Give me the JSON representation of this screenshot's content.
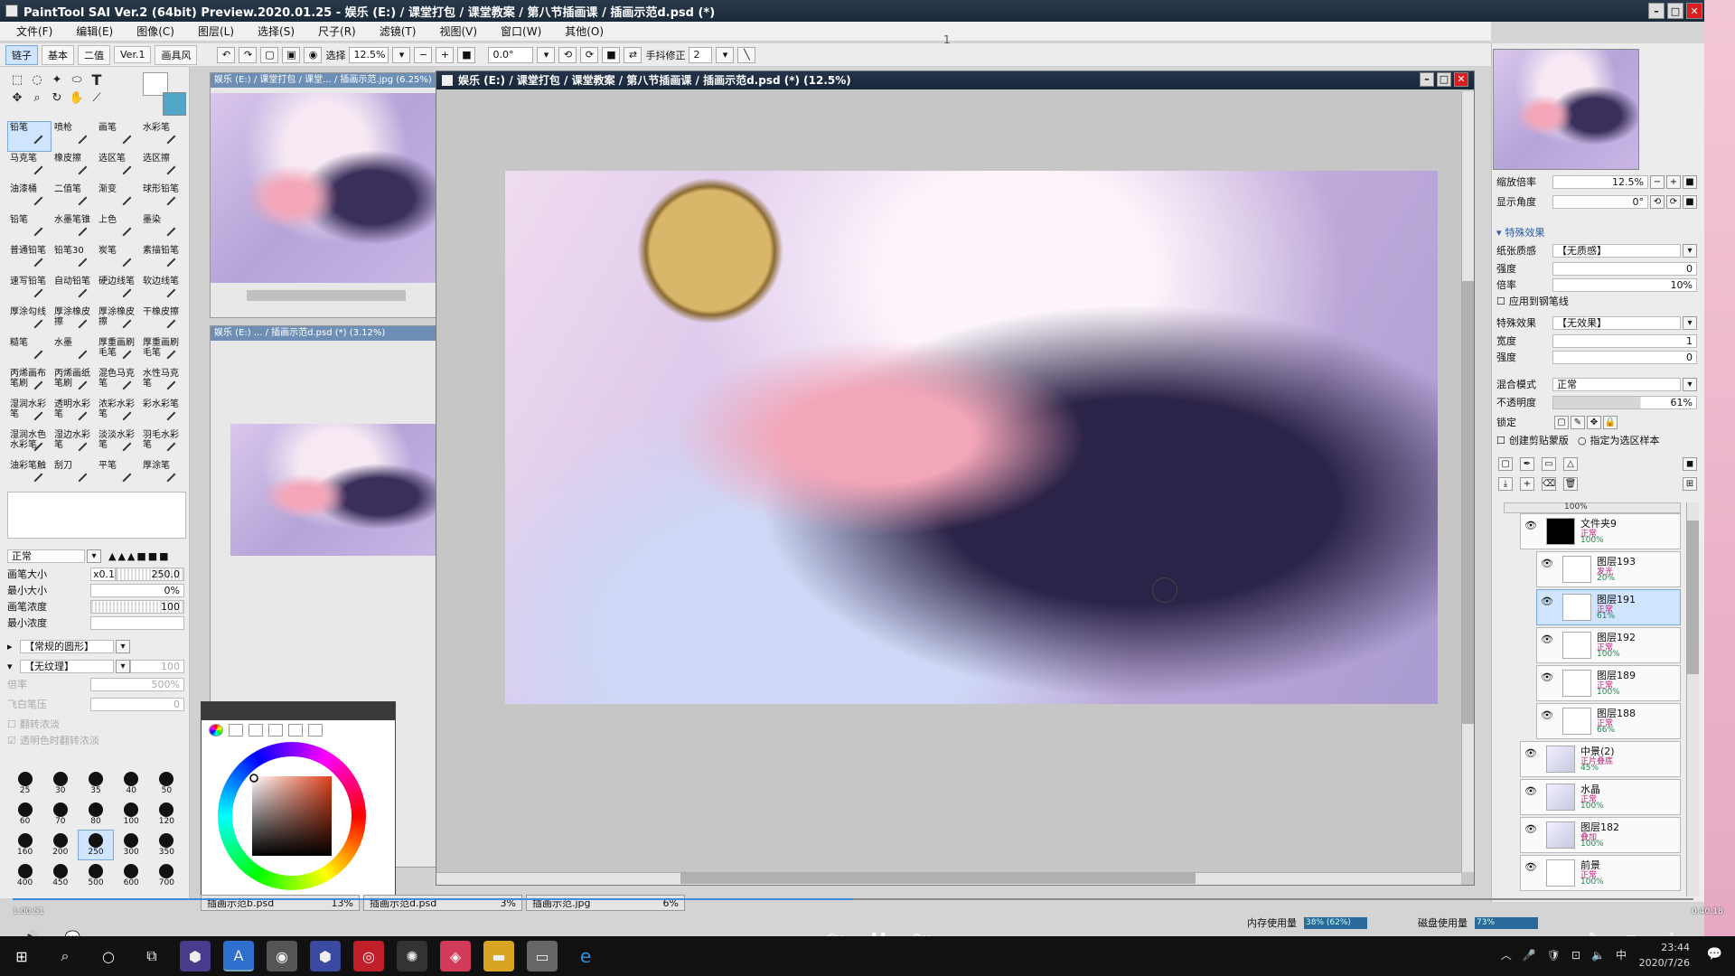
{
  "window": {
    "title": "PaintTool SAI Ver.2 (64bit) Preview.2020.01.25 - 娱乐 (E:) / 课堂打包 / 课堂教案 / 第八节插画课 / 插画示范d.psd (*)",
    "page_indicator": "1"
  },
  "menu": [
    "文件(F)",
    "编辑(E)",
    "图像(C)",
    "图层(L)",
    "选择(S)",
    "尺子(R)",
    "滤镜(T)",
    "视图(V)",
    "窗口(W)",
    "其他(O)"
  ],
  "toolbar": {
    "tabs": [
      "链子",
      "基本",
      "二值",
      "Ver.1",
      "画具风"
    ],
    "select_label": "选择",
    "zoom": "12.5%",
    "angle": "0.0°",
    "stabilizer_label": "手抖修正",
    "stabilizer_value": "2"
  },
  "brushes": [
    "铅笔",
    "喷枪",
    "画笔",
    "水彩笔",
    "马克笔",
    "橡皮擦",
    "选区笔",
    "选区擦",
    "油漆桶",
    "二值笔",
    "渐变",
    "球形铅笔",
    "铅笔",
    "水墨笔锥",
    "上色",
    "墨染",
    "普通铅笔",
    "铅笔30",
    "炭笔",
    "素描铅笔",
    "速写铅笔",
    "自动铅笔",
    "硬边线笔",
    "软边线笔",
    "厚涂勾线",
    "厚涂橡皮擦",
    "厚涂橡皮擦",
    "干橡皮擦",
    "糙笔",
    "水墨",
    "厚重画刷毛笔",
    "厚重画刷毛笔",
    "丙烯画布笔刷",
    "丙烯画纸笔刷",
    "混色马克笔",
    "水性马克笔",
    "湿润水彩笔",
    "透明水彩笔",
    "浓彩水彩笔",
    "彩水彩笔",
    "湿润水色水彩笔",
    "湿边水彩笔",
    "淡淡水彩笔",
    "羽毛水彩笔",
    "油彩笔触",
    "刮刀",
    "平笔",
    "厚涂笔"
  ],
  "brush_settings": {
    "mode": "正常",
    "size_label": "画笔大小",
    "size_mult": "x0.1",
    "size_value": "250.0",
    "min_size_label": "最小大小",
    "min_size_value": "0%",
    "density_label": "画笔浓度",
    "density_value": "100",
    "min_density_label": "最小浓度",
    "shape_label": "【常规的圆形】",
    "texture_label": "【无纹理】",
    "texture_value": "100",
    "texture_strength_label": "倍率",
    "texture_strength_value": "500%",
    "fly_label": "飞白笔压",
    "fly_value": "0",
    "opt1": "翻转浓淡",
    "opt2": "透明色时翻转浓淡"
  },
  "brush_sizes": [
    "25",
    "30",
    "35",
    "40",
    "50",
    "60",
    "70",
    "80",
    "100",
    "120",
    "160",
    "200",
    "250",
    "300",
    "350",
    "400",
    "450",
    "500",
    "600",
    "700"
  ],
  "documents": {
    "left_thumb_title": "娱乐 (E:) / 课堂打包 / 课堂... / 插画示范.jpg (6.25%)",
    "left_thumb2_title": "娱乐 (E:) ... / 插画示范d.psd (*) (3.12%)",
    "main_title": "娱乐 (E:) / 课堂打包 / 课堂教案 / 第八节插画课 / 插画示范d.psd (*) (12.5%)"
  },
  "navigator": {
    "zoom_label": "缩放倍率",
    "zoom_value": "12.5%",
    "angle_label": "显示角度",
    "angle_value": "0°"
  },
  "effects": {
    "section": "特殊效果",
    "paper_label": "纸张质感",
    "paper_value": "【无质感】",
    "strength_label": "强度",
    "strength_value": "0",
    "rate_label": "倍率",
    "rate_value": "10%",
    "apply_label": "应用到钢笔线",
    "effect_label": "特殊效果",
    "effect_value": "【无效果】",
    "width_label": "宽度",
    "width_value": "1",
    "strength2_label": "强度",
    "strength2_value": "0"
  },
  "layer_props": {
    "blend_label": "混合模式",
    "blend_value": "正常",
    "opacity_label": "不透明度",
    "opacity_value": "61%",
    "lock_label": "锁定",
    "clip_label": "创建剪贴蒙版",
    "sample_label": "指定为选区样本"
  },
  "layers": [
    {
      "name": "100%",
      "mode": "",
      "opacity": ""
    },
    {
      "name": "文件夹9",
      "mode": "正常",
      "opacity": "100%"
    },
    {
      "name": "图层193",
      "mode": "发光",
      "opacity": "20%"
    },
    {
      "name": "图层191",
      "mode": "正常",
      "opacity": "61%"
    },
    {
      "name": "图层192",
      "mode": "正常",
      "opacity": "100%"
    },
    {
      "name": "图层189",
      "mode": "正常",
      "opacity": "100%"
    },
    {
      "name": "图层188",
      "mode": "正常",
      "opacity": "66%"
    },
    {
      "name": "中景(2)",
      "mode": "正片叠底",
      "opacity": "45%"
    },
    {
      "name": "水晶",
      "mode": "正常",
      "opacity": "100%"
    },
    {
      "name": "图层182",
      "mode": "叠加",
      "opacity": "100%"
    },
    {
      "name": "前景",
      "mode": "正常",
      "opacity": "100%"
    }
  ],
  "doc_tabs": [
    {
      "name": "插画示范b.psd",
      "zoom": "13%"
    },
    {
      "name": "插画示范d.psd",
      "zoom": "3%"
    },
    {
      "name": "插画示范.jpg",
      "zoom": "6%"
    }
  ],
  "status": {
    "mem_label": "内存使用量",
    "mem_value": "38% (62%)",
    "disk_label": "磁盘使用量",
    "disk_value": "73%"
  },
  "video": {
    "current": "1:00:51",
    "total": "0:40:18",
    "back": "10",
    "fwd": "30",
    "progress": 0.5
  },
  "clock": {
    "time": "23:44",
    "date": "2020/7/26",
    "ime": "中"
  }
}
